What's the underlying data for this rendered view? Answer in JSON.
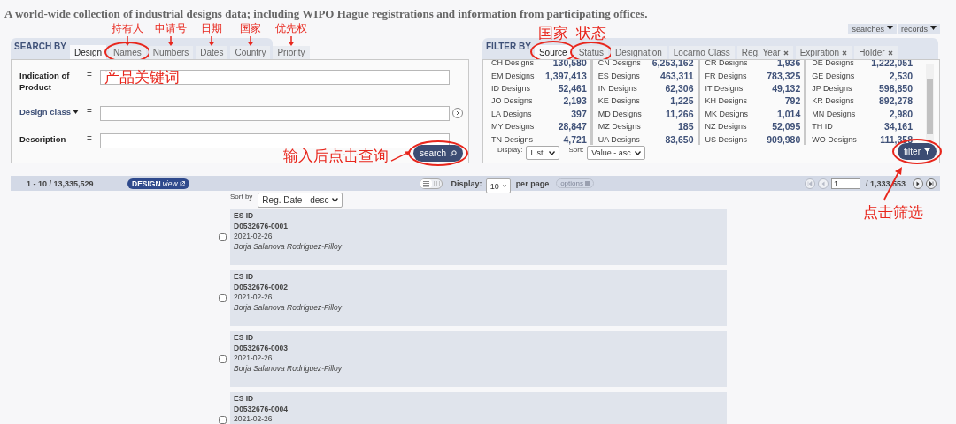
{
  "tagline": "A world-wide collection of industrial designs data; including WIPO Hague registrations and information from participating offices.",
  "top_menu": [
    {
      "label": "searches"
    },
    {
      "label": "records"
    }
  ],
  "search_panel": {
    "title": "SEARCH BY",
    "tabs": [
      {
        "label": "Design",
        "selected": true,
        "circled": false
      },
      {
        "label": "Names",
        "selected": false,
        "circled": true,
        "note": "持有人"
      },
      {
        "label": "Numbers",
        "selected": false,
        "circled": false,
        "note": "申请号"
      },
      {
        "label": "Dates",
        "selected": false,
        "circled": false,
        "note": "日期"
      },
      {
        "label": "Country",
        "selected": false,
        "circled": false,
        "note": "国家"
      },
      {
        "label": "Priority",
        "selected": false,
        "circled": false,
        "note": "优先权"
      }
    ],
    "fields": [
      {
        "kind": "text",
        "label": "Indication of Product",
        "operator": "=",
        "annotation": "产品关键词"
      },
      {
        "kind": "dropdown",
        "label": "Design class",
        "operator": "="
      },
      {
        "kind": "text",
        "label": "Description",
        "operator": "="
      }
    ],
    "button": {
      "label": "search",
      "circled": true,
      "note": "输入后点击查询"
    }
  },
  "filter_panel": {
    "title": "FILTER BY",
    "tabs": [
      {
        "label": "Source",
        "selected": true,
        "circled": true,
        "note": "国家",
        "removable": false
      },
      {
        "label": "Status",
        "selected": false,
        "circled": true,
        "note": "状态",
        "removable": false
      },
      {
        "label": "Designation",
        "selected": false,
        "circled": false,
        "removable": false
      },
      {
        "label": "Locarno Class",
        "selected": false,
        "circled": false,
        "removable": false
      },
      {
        "label": "Reg. Year",
        "selected": false,
        "circled": false,
        "removable": true
      },
      {
        "label": "Expiration",
        "selected": false,
        "circled": false,
        "removable": true
      },
      {
        "label": "Holder",
        "selected": false,
        "circled": false,
        "removable": true
      }
    ],
    "facets": [
      {
        "name": "CH Designs",
        "count": "130,580"
      },
      {
        "name": "CN Designs",
        "count": "6,253,162"
      },
      {
        "name": "CR Designs",
        "count": "1,936"
      },
      {
        "name": "DE Designs",
        "count": "1,222,051"
      },
      {
        "name": "EM Designs",
        "count": "1,397,413"
      },
      {
        "name": "ES Designs",
        "count": "463,311"
      },
      {
        "name": "FR Designs",
        "count": "783,325"
      },
      {
        "name": "GE Designs",
        "count": "2,530"
      },
      {
        "name": "ID Designs",
        "count": "52,461"
      },
      {
        "name": "IN Designs",
        "count": "62,306"
      },
      {
        "name": "IT Designs",
        "count": "49,132"
      },
      {
        "name": "JP Designs",
        "count": "598,850"
      },
      {
        "name": "JO Designs",
        "count": "2,193"
      },
      {
        "name": "KE Designs",
        "count": "1,225"
      },
      {
        "name": "KH Designs",
        "count": "792"
      },
      {
        "name": "KR Designs",
        "count": "892,278"
      },
      {
        "name": "LA Designs",
        "count": "397"
      },
      {
        "name": "MD Designs",
        "count": "11,266"
      },
      {
        "name": "MK Designs",
        "count": "1,014"
      },
      {
        "name": "MN Designs",
        "count": "2,980"
      },
      {
        "name": "MY Designs",
        "count": "28,847"
      },
      {
        "name": "MZ Designs",
        "count": "185"
      },
      {
        "name": "NZ Designs",
        "count": "52,095"
      },
      {
        "name": "TH ID",
        "count": "34,161"
      },
      {
        "name": "TN Designs",
        "count": "4,721"
      },
      {
        "name": "UA Designs",
        "count": "83,650"
      },
      {
        "name": "US Designs",
        "count": "909,980"
      },
      {
        "name": "WO Designs",
        "count": "111,358"
      }
    ],
    "display": {
      "label": "Display:",
      "value": "List"
    },
    "sort": {
      "label": "Sort:",
      "value": "Value - asc"
    },
    "button": {
      "label": "filter",
      "circled": true,
      "note": "点击筛选"
    }
  },
  "results_bar": {
    "range": "1 - 10 / 13,335,529",
    "badge": {
      "main": "DESIGN",
      "sub": "view"
    },
    "display_label": "Display:",
    "per_page": "10",
    "per_page_label": "per page",
    "options": "options",
    "page": "1",
    "page_total": "/ 1,333,553"
  },
  "sort": {
    "label": "Sort by",
    "value": "Reg. Date - desc"
  },
  "records": [
    {
      "source": "ES ID",
      "number": "D0532676-0001",
      "date": "2021-02-26",
      "holder": "Borja Salanova Rodríguez-Filloy",
      "checked": false
    },
    {
      "source": "ES ID",
      "number": "D0532676-0002",
      "date": "2021-02-26",
      "holder": "Borja Salanova Rodríguez-Filloy",
      "checked": false
    },
    {
      "source": "ES ID",
      "number": "D0532676-0003",
      "date": "2021-02-26",
      "holder": "Borja Salanova Rodríguez-Filloy",
      "checked": false
    },
    {
      "source": "ES ID",
      "number": "D0532676-0004",
      "date": "2021-02-26",
      "checked": false
    }
  ]
}
